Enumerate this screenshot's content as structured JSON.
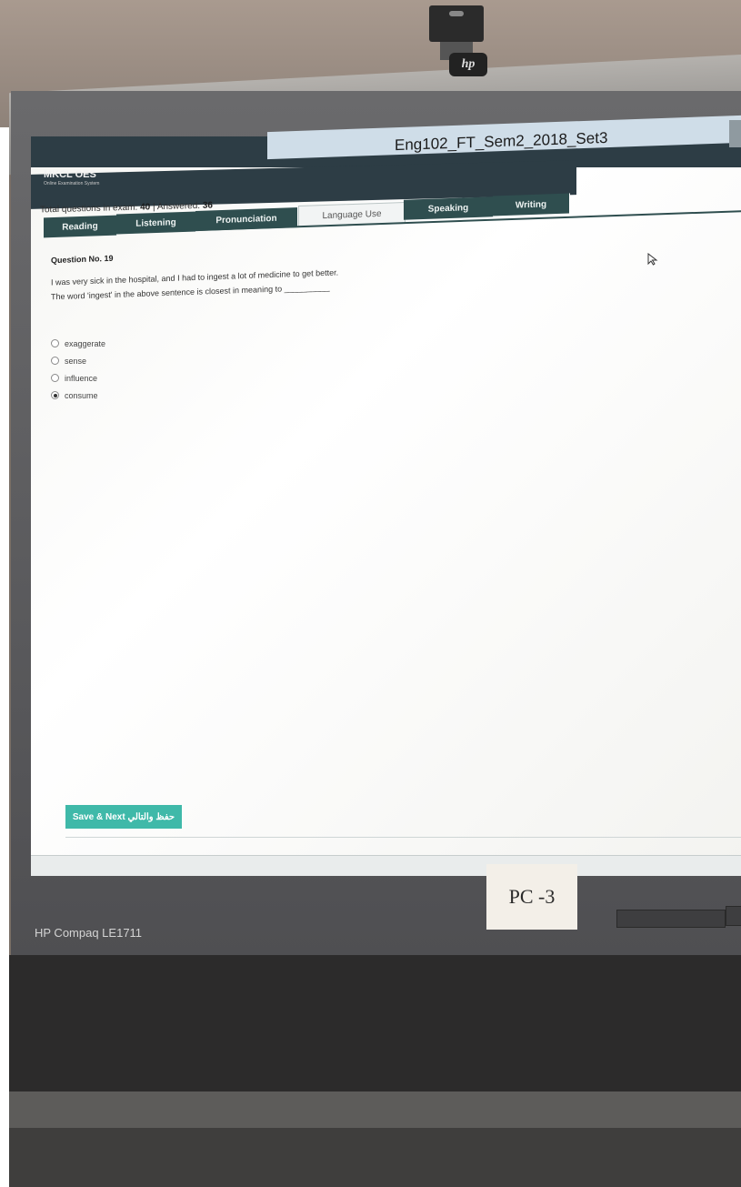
{
  "exam_title": "Eng102_FT_Sem2_2018_Set3",
  "app": {
    "name": "MKCL OES",
    "subtitle": "Online Examination System"
  },
  "status": {
    "total_label": "Total questions in exam:",
    "total": "40",
    "separator": "|",
    "answered_label": "Answered:",
    "answered": "36"
  },
  "tabs": [
    "Reading",
    "Listening",
    "Pronunciation",
    "Language Use",
    "Speaking",
    "Writing"
  ],
  "active_tab": "Language Use",
  "question": {
    "number_label": "Question No. 19",
    "line1": "I was very sick in the hospital, and I had to ingest a lot of medicine to get better.",
    "line2": "The word 'ingest' in the above sentence is closest in meaning to __________",
    "options": [
      "exaggerate",
      "sense",
      "influence",
      "consume"
    ],
    "selected": "consume"
  },
  "save_button": "Save & Next حفظ والتالي",
  "monitor": {
    "pc_label": "PC -3",
    "model": "HP Compaq LE1711",
    "logo": "hp"
  }
}
